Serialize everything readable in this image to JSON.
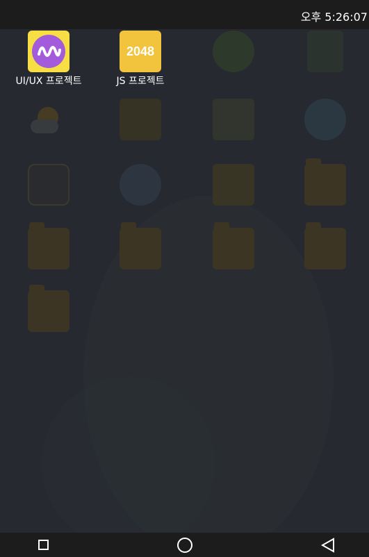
{
  "status_bar": {
    "time": "오후 5:26:07"
  },
  "apps": {
    "uiux": {
      "label": "UI/UX 프로젝트",
      "icon": "wave-logo-icon"
    },
    "js": {
      "label": "JS 프로젝트",
      "icon_text": "2048"
    }
  },
  "nav": {
    "recents": "recents-icon",
    "home": "home-icon",
    "back": "back-icon"
  }
}
